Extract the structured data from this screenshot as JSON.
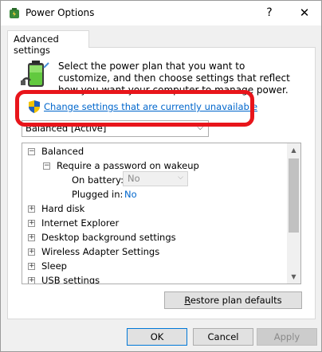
{
  "window": {
    "title": "Power Options",
    "help_label": "?",
    "close_label": "✕"
  },
  "tab": {
    "label": "Advanced settings"
  },
  "intro": {
    "text": "Select the power plan that you want to customize, and then choose settings that reflect how you want your computer to manage power."
  },
  "change_link": {
    "label": "Change settings that are currently unavailable"
  },
  "plan_select": {
    "value": "Balanced [Active]"
  },
  "tree": {
    "balanced": {
      "toggle": "−",
      "label": "Balanced"
    },
    "require_password": {
      "toggle": "−",
      "label": "Require a password on wakeup"
    },
    "on_battery": {
      "label": "On battery:",
      "value": "No"
    },
    "plugged_in": {
      "label": "Plugged in:",
      "value": "No"
    },
    "items": [
      {
        "toggle": "+",
        "label": "Hard disk"
      },
      {
        "toggle": "+",
        "label": "Internet Explorer"
      },
      {
        "toggle": "+",
        "label": "Desktop background settings"
      },
      {
        "toggle": "+",
        "label": "Wireless Adapter Settings"
      },
      {
        "toggle": "+",
        "label": "Sleep"
      },
      {
        "toggle": "+",
        "label": "USB settings"
      }
    ]
  },
  "restore_button": {
    "accel": "R",
    "rest": "estore plan defaults"
  },
  "buttons": {
    "ok": "OK",
    "cancel": "Cancel",
    "apply": "Apply"
  },
  "colors": {
    "link": "#0066cc",
    "highlight": "#e8151b",
    "focus_border": "#0078d7"
  },
  "icons": {
    "app": "power-options-icon",
    "battery": "battery-plug-icon",
    "shield": "uac-shield-icon"
  }
}
